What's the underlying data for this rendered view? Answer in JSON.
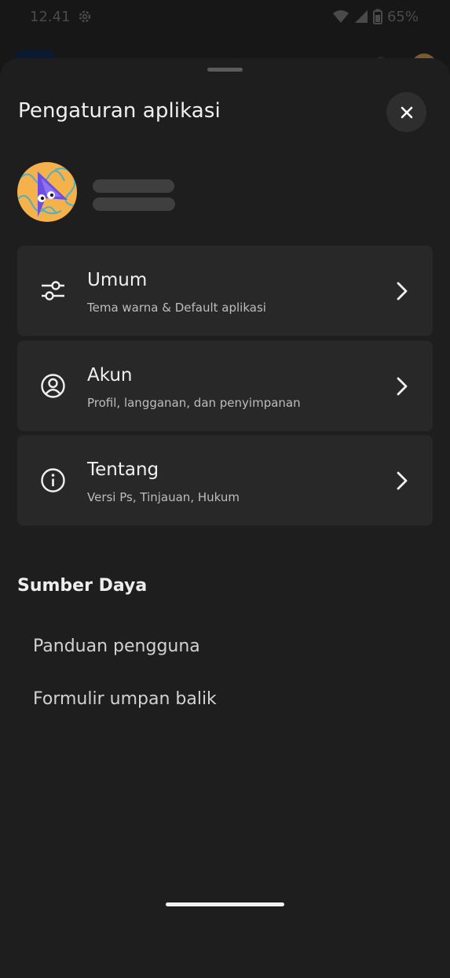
{
  "status_bar": {
    "time": "12.41",
    "battery": "65%",
    "icons": [
      "settings-gear-icon",
      "wifi-icon",
      "signal-icon",
      "battery-icon"
    ]
  },
  "sheet": {
    "title": "Pengaturan aplikasi",
    "close_icon": "close-icon",
    "items": [
      {
        "title": "Umum",
        "subtitle": "Tema warna & Default aplikasi",
        "icon": "sliders-icon"
      },
      {
        "title": "Akun",
        "subtitle": "Profil, langganan, dan penyimpanan",
        "icon": "user-circle-icon"
      },
      {
        "title": "Tentang",
        "subtitle": "Versi Ps, Tinjauan, Hukum",
        "icon": "info-icon"
      }
    ],
    "resources": {
      "title": "Sumber Daya",
      "links": [
        "Panduan pengguna",
        "Formulir umpan balik"
      ]
    }
  },
  "colors": {
    "background": "#1e1e1e",
    "card": "#282828",
    "avatar_bg": "#f5b14a",
    "avatar_arrow": "#6c4fe0"
  }
}
